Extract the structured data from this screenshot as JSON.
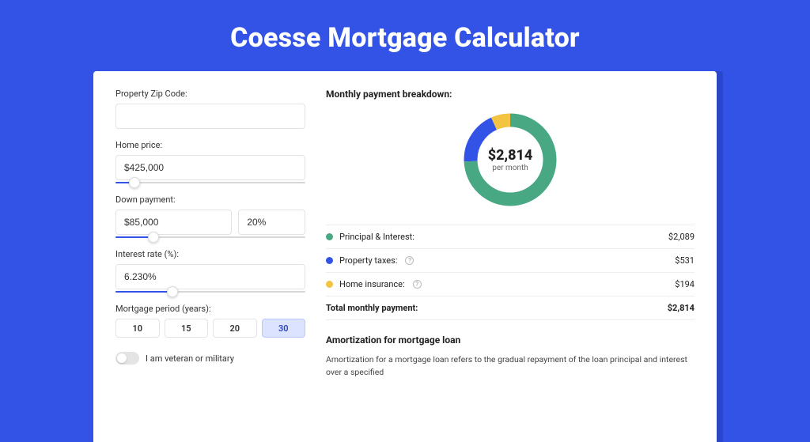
{
  "page": {
    "title": "Coesse Mortgage Calculator"
  },
  "form": {
    "zip": {
      "label": "Property Zip Code:",
      "value": ""
    },
    "home_price": {
      "label": "Home price:",
      "value": "$425,000",
      "slider_pct": 10
    },
    "down_payment": {
      "label": "Down payment:",
      "amount": "$85,000",
      "pct": "20%",
      "slider_pct": 20
    },
    "interest_rate": {
      "label": "Interest rate (%):",
      "value": "6.230%",
      "slider_pct": 30
    },
    "period": {
      "label": "Mortgage period (years):",
      "options": [
        "10",
        "15",
        "20",
        "30"
      ],
      "selected": "30"
    },
    "veteran": {
      "label": "I am veteran or military",
      "on": false
    }
  },
  "breakdown": {
    "title": "Monthly payment breakdown:",
    "center_value": "$2,814",
    "center_sub": "per month",
    "items": [
      {
        "label": "Principal & Interest:",
        "value": "$2,089",
        "color": "#49a884",
        "info": false
      },
      {
        "label": "Property taxes:",
        "value": "$531",
        "color": "#3353e6",
        "info": true
      },
      {
        "label": "Home insurance:",
        "value": "$194",
        "color": "#f3c441",
        "info": true
      }
    ],
    "total": {
      "label": "Total monthly payment:",
      "value": "$2,814"
    }
  },
  "chart_data": {
    "type": "pie",
    "title": "Monthly payment breakdown",
    "series": [
      {
        "name": "Principal & Interest",
        "value": 2089,
        "color": "#49a884"
      },
      {
        "name": "Property taxes",
        "value": 531,
        "color": "#3353e6"
      },
      {
        "name": "Home insurance",
        "value": 194,
        "color": "#f3c441"
      }
    ],
    "total": 2814
  },
  "amortization": {
    "title": "Amortization for mortgage loan",
    "text": "Amortization for a mortgage loan refers to the gradual repayment of the loan principal and interest over a specified"
  }
}
